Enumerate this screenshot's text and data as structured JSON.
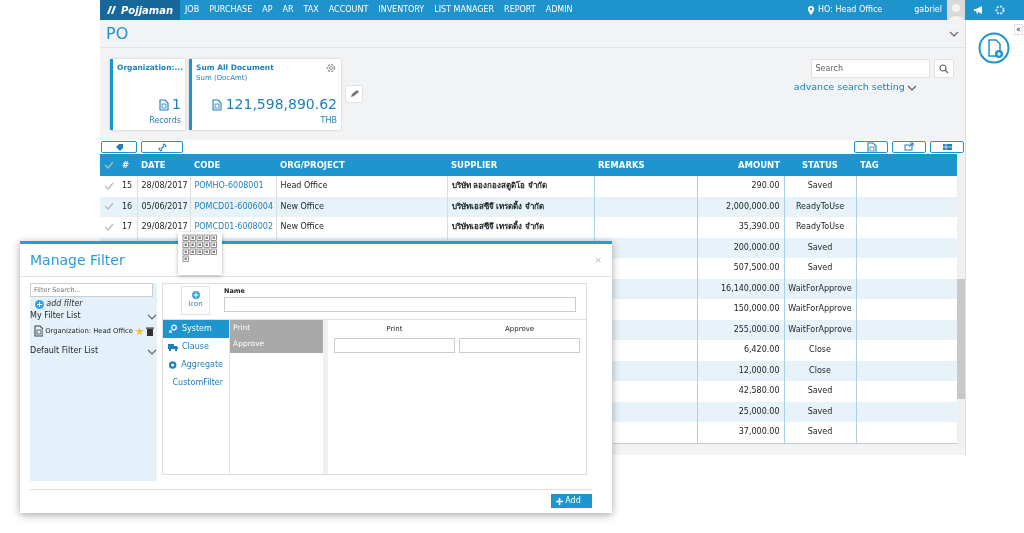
{
  "nav": {
    "brand": "Pojjaman",
    "menu": [
      "JOB",
      "PURCHASE",
      "AP",
      "AR",
      "TAX",
      "ACCOUNT",
      "INVENTORY",
      "LIST MANAGER",
      "REPORT",
      "ADMIN"
    ],
    "location": "HO: Head Office",
    "user": "gabriel"
  },
  "page": {
    "title": "PO",
    "collapse": "«"
  },
  "cards": [
    {
      "title": "Organization:...",
      "value": "1",
      "caption": "Records"
    },
    {
      "title": "Sum All Document",
      "subtitle": "Sum (DocAmt)",
      "value": "121,598,890.62",
      "caption": "THB"
    }
  ],
  "search": {
    "placeholder": "Search",
    "advanced_link": "advance search setting"
  },
  "table": {
    "columns": [
      "#",
      "DATE",
      "CODE",
      "ORG/PROJECT",
      "SUPPLIER",
      "REMARKS",
      "AMOUNT",
      "STATUS",
      "TAG"
    ],
    "all_checked": false,
    "rows": [
      {
        "checked": false,
        "number": "15",
        "date": "28/08/2017",
        "code": "POMHO-6008001",
        "org": "Head Office",
        "supplier": "บริษัท ลองกองสตูดิโอ จำกัด",
        "amount": "290.00",
        "status": "Saved"
      },
      {
        "checked": false,
        "number": "16",
        "date": "05/06/2017",
        "code": "POMCD01-6006004",
        "org": "New Office",
        "supplier": "บริษัทเอสซีจี เทรดดิ้ง จำกัด",
        "amount": "2,000,000.00",
        "status": "ReadyToUse"
      },
      {
        "checked": false,
        "number": "17",
        "date": "29/08/2017",
        "code": "POMCD01-6008002",
        "org": "New Office",
        "supplier": "บริษัทเอสซีจี เทรดดิ้ง จำกัด",
        "amount": "35,390.00",
        "status": "ReadyToUse"
      },
      {
        "amount": "200,000.00",
        "status": "Saved"
      },
      {
        "amount": "507,500.00",
        "status": "Saved"
      },
      {
        "amount": "16,140,000.00",
        "status": "WaitForApprove"
      },
      {
        "amount": "150,000.00",
        "status": "WaitForApprove"
      },
      {
        "amount": "255,000.00",
        "status": "WaitForApprove"
      },
      {
        "amount": "6,420.00",
        "status": "Close"
      },
      {
        "amount": "12,000.00",
        "status": "Close"
      },
      {
        "amount": "42,580.00",
        "status": "Saved"
      },
      {
        "amount": "25,000.00",
        "status": "Saved"
      },
      {
        "amount": "37,000.00",
        "status": "Saved"
      }
    ]
  },
  "modal": {
    "title": "Manage Filter",
    "close": "×",
    "filter_search_placeholder": "Filter Search...",
    "add_filter": "add filter",
    "groups": [
      {
        "label": "My Filter List",
        "items": [
          {
            "label": "Organization: Head Office",
            "starred": true
          }
        ]
      },
      {
        "label": "Default Filter List"
      }
    ],
    "icon_button": "Icon",
    "name_label": "Name",
    "tabs": [
      {
        "label": "System",
        "selected": true
      },
      {
        "label": "Clause",
        "selected": false
      },
      {
        "label": "Aggregate",
        "selected": false
      },
      {
        "label": "CustomFilter",
        "selected": false
      }
    ],
    "list": [
      "Print",
      "Approve"
    ],
    "fields": [
      "Print",
      "Approve"
    ],
    "add_button": "Add"
  }
}
